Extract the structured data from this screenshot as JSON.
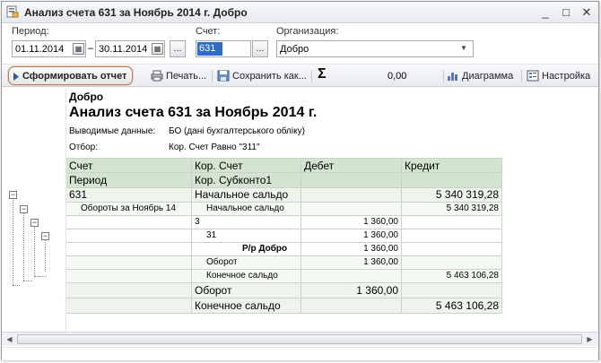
{
  "window": {
    "title": "Анализ счета 631 за Ноябрь 2014 г. Добро",
    "minimize": "_",
    "maximize": "□",
    "close": "✕"
  },
  "form": {
    "period_label": "Период:",
    "date_from": "01.11.2014",
    "date_sep": "–",
    "date_to": "30.11.2014",
    "ellipsis": "...",
    "account_label": "Счет:",
    "account_value": "631",
    "org_label": "Организация:",
    "org_value": "Добро",
    "dropdown_arrow": "▼"
  },
  "toolbar": {
    "generate": "Сформировать отчет",
    "print": "Печать...",
    "save_as": "Сохранить как...",
    "sum_symbol": "Σ",
    "sum_value": "0,00",
    "diagram": "Диаграмма",
    "settings": "Настройка"
  },
  "report": {
    "org_name": "Добро",
    "title": "Анализ счета 631 за Ноябрь 2014 г.",
    "output_label": "Выводимые данные:",
    "output_value": "БО (дані бухгалтерського обліку)",
    "filter_label": "Отбор:",
    "filter_value": "Кор. Счет Равно \"311\"",
    "headers": {
      "account": "Счет",
      "period": "Период",
      "corr_account": "Кор. Счет",
      "corr_subconto": "Кор. Субконто1",
      "debit": "Дебет",
      "credit": "Кредит"
    },
    "rows": [
      {
        "c1": "631",
        "c2": "Начальное сальдо",
        "debit": "",
        "credit": "5 340 319,28"
      },
      {
        "c1": "Обороты за Ноябрь 14",
        "c2": "Начальное сальдо",
        "debit": "",
        "credit": "5 340 319,28"
      },
      {
        "c1": "",
        "c2": "3",
        "debit": "1 360,00",
        "credit": ""
      },
      {
        "c1": "",
        "c2": "31",
        "debit": "1 360,00",
        "credit": ""
      },
      {
        "c1": "",
        "c2": "Р/р Добро",
        "debit": "1 360,00",
        "credit": ""
      },
      {
        "c1": "",
        "c2": "Оборот",
        "debit": "1 360,00",
        "credit": ""
      },
      {
        "c1": "",
        "c2": "Конечное сальдо",
        "debit": "",
        "credit": "5 463 106,28"
      },
      {
        "c1": "",
        "c2": "Оборот",
        "debit": "1 360,00",
        "credit": ""
      },
      {
        "c1": "",
        "c2": "Конечное сальдо",
        "debit": "",
        "credit": "5 463 106,28"
      }
    ]
  },
  "tree": {
    "collapse_glyph": "−"
  },
  "scroll": {
    "left_arrow": "◀",
    "right_arrow": "▶"
  }
}
